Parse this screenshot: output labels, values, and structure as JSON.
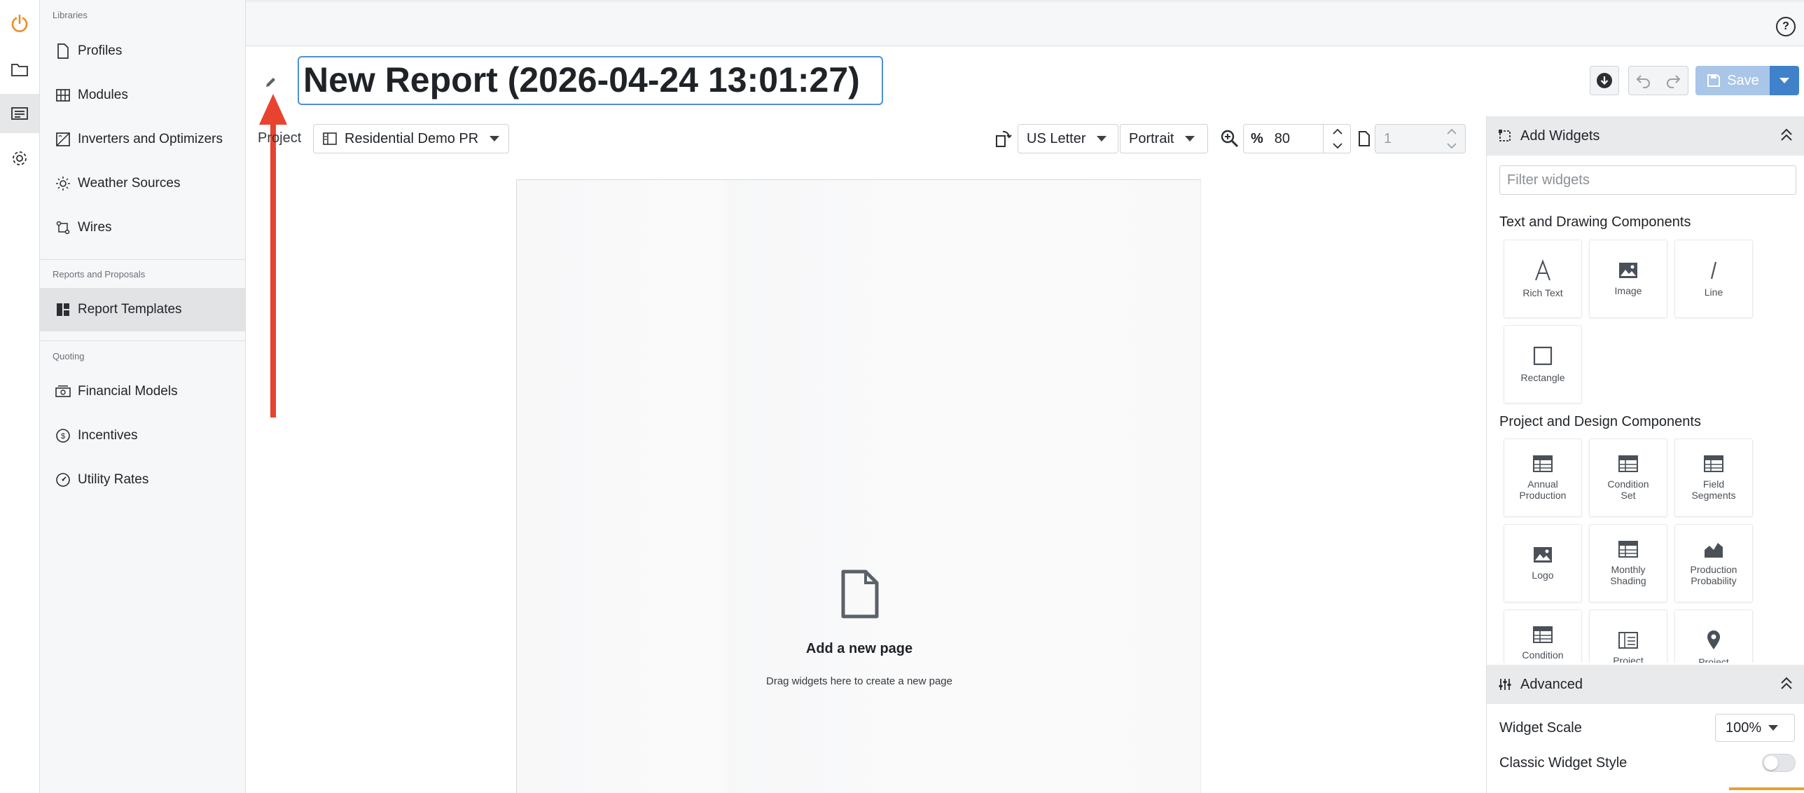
{
  "sidebar": {
    "libraries_label": "Libraries",
    "libraries": [
      {
        "label": "Profiles"
      },
      {
        "label": "Modules"
      },
      {
        "label": "Inverters and Optimizers"
      },
      {
        "label": "Weather Sources"
      },
      {
        "label": "Wires"
      }
    ],
    "reports_label": "Reports and Proposals",
    "reports": [
      {
        "label": "Report Templates"
      }
    ],
    "quoting_label": "Quoting",
    "quoting": [
      {
        "label": "Financial Models"
      },
      {
        "label": "Incentives"
      },
      {
        "label": "Utility Rates"
      }
    ]
  },
  "header": {
    "help_glyph": "?"
  },
  "report": {
    "title": "New Report (2026-04-24 13:01:27)",
    "save_label": "Save"
  },
  "toolbar": {
    "project_label": "Project",
    "project_value": "Residential Demo PR",
    "paper_size": "US Letter",
    "orientation": "Portrait",
    "zoom_unit": "%",
    "zoom_value": "80",
    "page_number": "1"
  },
  "canvas": {
    "empty_title": "Add a new page",
    "empty_subtitle": "Drag widgets here to create a new page"
  },
  "widgets_panel": {
    "title": "Add Widgets",
    "filter_placeholder": "Filter widgets",
    "groups": [
      {
        "title": "Text and Drawing Components",
        "items": [
          {
            "label": "Rich Text",
            "icon": "rich-text-icon"
          },
          {
            "label": "Image",
            "icon": "image-icon"
          },
          {
            "label": "Line",
            "icon": "line-icon"
          },
          {
            "label": "Rectangle",
            "icon": "rectangle-icon"
          }
        ]
      },
      {
        "title": "Project and Design Components",
        "items": [
          {
            "label": "Annual Production",
            "icon": "table-icon"
          },
          {
            "label": "Condition Set",
            "icon": "table-icon"
          },
          {
            "label": "Field Segments",
            "icon": "table-icon"
          },
          {
            "label": "Logo",
            "icon": "image-icon"
          },
          {
            "label": "Monthly Shading",
            "icon": "table-icon"
          },
          {
            "label": "Production Probability",
            "icon": "area-chart-icon"
          },
          {
            "label": "Condition Set",
            "icon": "table-icon"
          },
          {
            "label": "Project",
            "icon": "card-icon"
          },
          {
            "label": "Project",
            "icon": "map-pin-icon"
          }
        ]
      }
    ],
    "advanced": {
      "title": "Advanced",
      "widget_scale_label": "Widget Scale",
      "widget_scale_value": "100%",
      "classic_style_label": "Classic Widget Style",
      "classic_style_on": false
    }
  },
  "colors": {
    "accent": "#3f82c9",
    "save_disabled": "#a9c6e8",
    "annotation_arrow": "#e8432f",
    "brand_power": "#f08a24"
  }
}
